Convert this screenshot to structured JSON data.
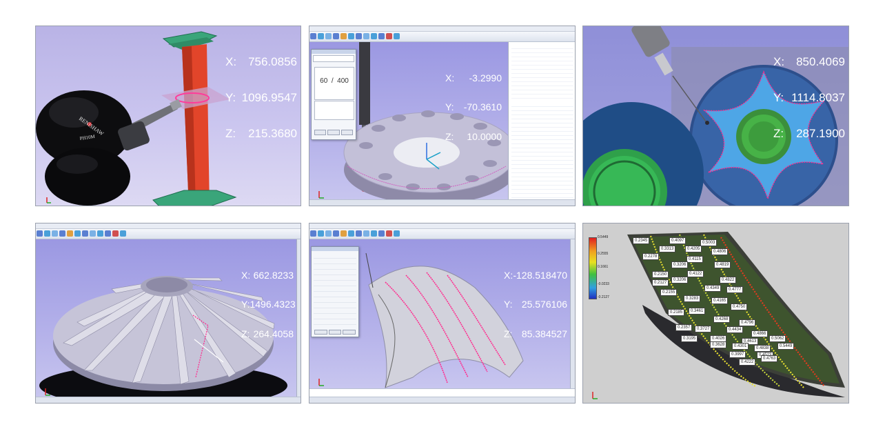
{
  "panels": [
    {
      "id": "p1",
      "coords": {
        "x_label": "X:",
        "x": "756.0856",
        "y_label": "Y:",
        "y": "1096.9547",
        "z_label": "Z:",
        "z": "215.3680"
      },
      "probe_brand": "RENISHAW",
      "probe_model": "PH10M"
    },
    {
      "id": "p2",
      "coords": {
        "x_label": "X:",
        "x": "-3.2990",
        "y_label": "Y:",
        "y": "-70.3610",
        "z_label": "Z:",
        "z": "10.0000"
      },
      "progress_text": "60  /  400",
      "progress_current": 60,
      "progress_total": 400,
      "dialog_buttons": [
        "",
        "",
        ""
      ]
    },
    {
      "id": "p3",
      "coords": {
        "x_label": "X:",
        "x": "850.4069",
        "y_label": "Y:",
        "y": "1114.8037",
        "z_label": "Z:",
        "z": "287.1900"
      }
    },
    {
      "id": "p4",
      "coords": {
        "x_label": "X:",
        "x": "662.8233",
        "y_label": "Y:",
        "y": "1496.4323",
        "z_label": "Z:",
        "z": "264.4058"
      }
    },
    {
      "id": "p5",
      "coords": {
        "x_label": "X:",
        "x": "-128.518470",
        "y_label": "Y:",
        "y": "25.576106",
        "z_label": "Z:",
        "z": "85.384527"
      }
    },
    {
      "id": "p6",
      "legend": [
        "0.5449",
        "0.2555",
        "0.1661",
        "-0.0233",
        "-0.2127"
      ],
      "labels": [
        "0.2345",
        "0.4097",
        "0.5003",
        "0.3313",
        "0.4205",
        "0.4806",
        "0.2278",
        "0.4115",
        "0.3206",
        "0.4819",
        "0.2150",
        "0.4122",
        "0.3206",
        "0.4822",
        "0.2127",
        "0.4349",
        "0.2155",
        "0.4777",
        "0.3283",
        "0.4165",
        "0.2185",
        "0.4750",
        "0.3461",
        "0.4268",
        "0.2357",
        "0.4796",
        "0.3727",
        "0.4434",
        "0.4866",
        "0.3195",
        "0.4026",
        "0.4613",
        "0.5062",
        "0.3628",
        "0.4301",
        "0.4838",
        "0.5449",
        "0.3997",
        "0.4523",
        "0.4222",
        "0.4763"
      ]
    }
  ],
  "colors": {
    "viewport": "#9b98e2",
    "blade_red": "#e84a2a",
    "blade_green": "#2f9a6a",
    "probe_highlight": "#ff3c9a",
    "grey_part": "#b8b8c8"
  }
}
